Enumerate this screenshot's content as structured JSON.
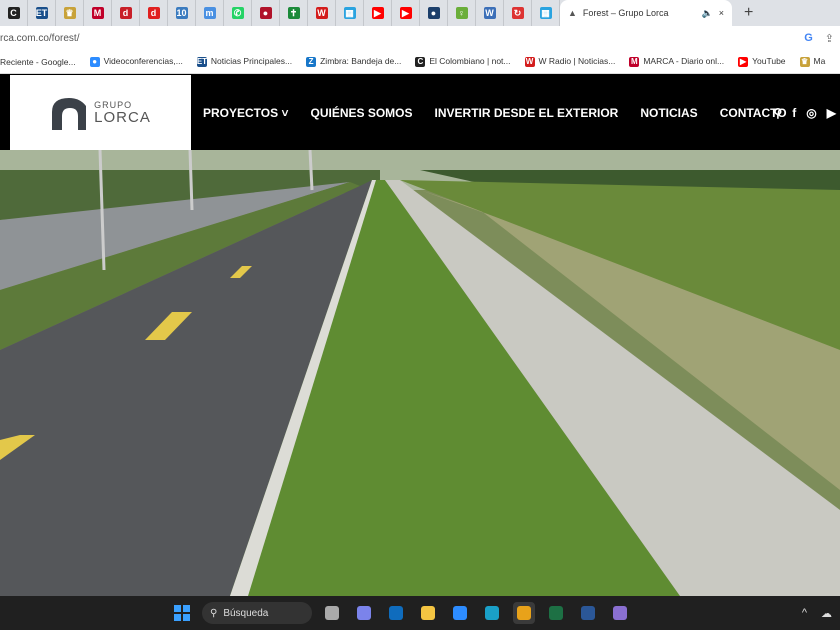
{
  "browser": {
    "active_tab": {
      "title": "Forest – Grupo Lorca",
      "audio_icon": "speaker-icon",
      "close": "×"
    },
    "new_tab": "+",
    "favicon_tabs": [
      {
        "label": "C",
        "color": "#222"
      },
      {
        "label": "ET",
        "color": "#1a4f8b"
      },
      {
        "label": "♛",
        "color": "#c8a23a"
      },
      {
        "label": "M",
        "color": "#c0002a"
      },
      {
        "label": "d",
        "color": "#c81f28"
      },
      {
        "label": "d",
        "color": "#e02020"
      },
      {
        "label": "10",
        "color": "#3b7bbf"
      },
      {
        "label": "m",
        "color": "#4a90e2"
      },
      {
        "label": "✆",
        "color": "#25d366"
      },
      {
        "label": "●",
        "color": "#b0122a"
      },
      {
        "label": "✝",
        "color": "#1b8a3a"
      },
      {
        "label": "W",
        "color": "#d31c1c"
      },
      {
        "label": "▦",
        "color": "#2aa3e0"
      },
      {
        "label": "▶",
        "color": "#ff0000"
      },
      {
        "label": "▶",
        "color": "#ff0000"
      },
      {
        "label": "●",
        "color": "#1c3f6b"
      },
      {
        "label": "♀",
        "color": "#6aae3a"
      },
      {
        "label": "W",
        "color": "#3c6fb8"
      },
      {
        "label": "↻",
        "color": "#d33"
      },
      {
        "label": "▦",
        "color": "#2aa3e0"
      }
    ],
    "url": "rca.com.co/forest/",
    "bookmarks": [
      {
        "label": "Reciente - Google...",
        "color": "#999",
        "glyph": ""
      },
      {
        "label": "Videoconferencias,...",
        "color": "#2d8cff",
        "glyph": "●"
      },
      {
        "label": "Noticias Principales...",
        "color": "#1a4f8b",
        "glyph": "ET"
      },
      {
        "label": "Zimbra: Bandeja de...",
        "color": "#1877c9",
        "glyph": "Z"
      },
      {
        "label": "El Colombiano | not...",
        "color": "#222",
        "glyph": "C"
      },
      {
        "label": "W Radio | Noticias...",
        "color": "#d31c1c",
        "glyph": "W"
      },
      {
        "label": "MARCA - Diario onl...",
        "color": "#c0002a",
        "glyph": "M"
      },
      {
        "label": "YouTube",
        "color": "#ff0000",
        "glyph": "▶"
      },
      {
        "label": "Ma",
        "color": "#c8a23a",
        "glyph": "♛"
      }
    ]
  },
  "site": {
    "logo": {
      "top": "GRUPO",
      "bottom": "LORCA"
    },
    "nav": [
      "PROYECTOS",
      "QUIÉNES SOMOS",
      "INVERTIR DESDE EL EXTERIOR",
      "NOTICIAS",
      "CONTACTO"
    ],
    "nav_dropdown": "˅",
    "icons": [
      "search-icon",
      "facebook-icon",
      "instagram-icon",
      "youtube-icon"
    ]
  },
  "taskbar": {
    "search_placeholder": "Búsqueda",
    "apps": [
      {
        "name": "task-view",
        "color": "#aaa"
      },
      {
        "name": "teams",
        "color": "#7b83eb"
      },
      {
        "name": "outlook",
        "color": "#0f6cbd"
      },
      {
        "name": "file-explorer",
        "color": "#f4c542"
      },
      {
        "name": "zoom",
        "color": "#2d8cff"
      },
      {
        "name": "edge",
        "color": "#1aa0c8"
      },
      {
        "name": "chrome",
        "color": "#e8a21a"
      },
      {
        "name": "excel",
        "color": "#1d7044"
      },
      {
        "name": "word",
        "color": "#2b5797"
      },
      {
        "name": "media-player",
        "color": "#8a6fd1"
      }
    ]
  }
}
